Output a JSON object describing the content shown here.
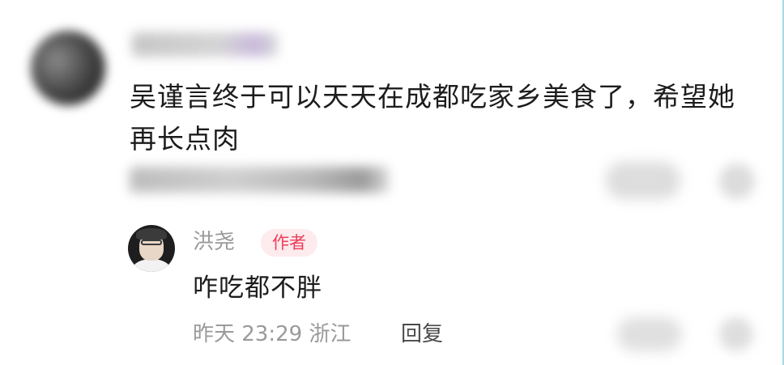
{
  "comment": {
    "text_line1": "吴谨言终于可以天天在成都吃家乡美食了，希望她",
    "text_line2": "再长点肉",
    "like_icon": "heart-icon",
    "more_icon": "more-icon"
  },
  "reply": {
    "username": "洪尧",
    "author_badge": "作者",
    "text": "咋吃都不胖",
    "meta": "昨天 23:29 浙江",
    "reply_label": "回复",
    "like_icon": "heart-icon",
    "more_icon": "more-icon",
    "badge_color": "#ef3e5a"
  }
}
